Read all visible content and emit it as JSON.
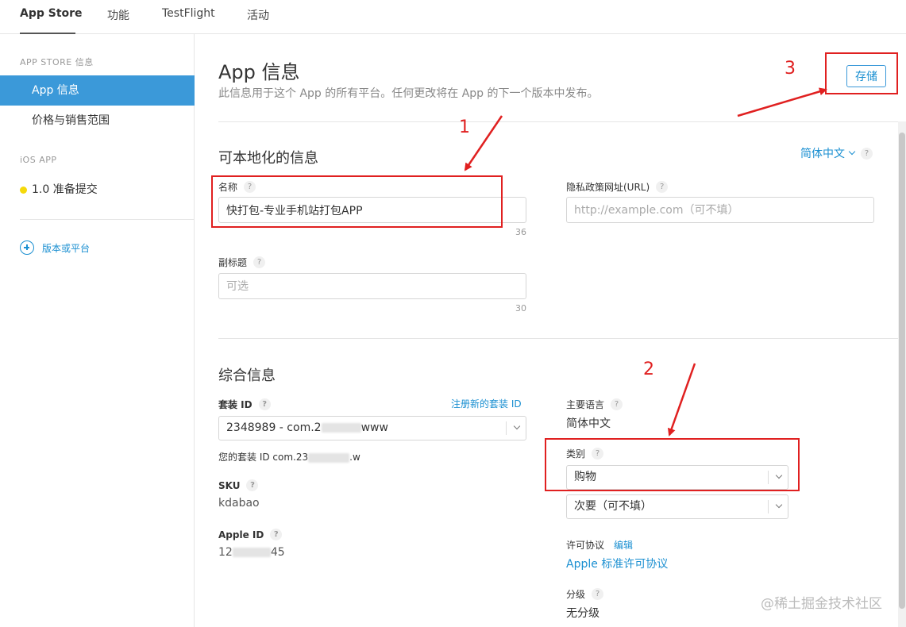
{
  "topnav": {
    "tabs": [
      {
        "label": "App Store"
      },
      {
        "label": "功能"
      },
      {
        "label": "TestFlight"
      },
      {
        "label": "活动"
      }
    ]
  },
  "sidebar": {
    "section_store": "APP STORE 信息",
    "items": [
      {
        "label": "App 信息"
      },
      {
        "label": "价格与销售范围"
      }
    ],
    "section_ios": "iOS APP",
    "version": "1.0 准备提交",
    "add_platform": "版本或平台"
  },
  "main": {
    "title": "App 信息",
    "subtitle": "此信息用于这个 App 的所有平台。任何更改将在 App 的下一个版本中发布。",
    "save_label": "存储",
    "localizable": {
      "title": "可本地化的信息",
      "language": "简体中文",
      "name_label": "名称",
      "name_value": "快打包-专业手机站打包APP",
      "name_counter": "36",
      "privacy_label": "隐私政策网址(URL)",
      "privacy_placeholder": "http://example.com（可不填）",
      "subtitle_label": "副标题",
      "subtitle_placeholder": "可选",
      "subtitle_counter": "30"
    },
    "general": {
      "title": "综合信息",
      "bundle_label": "套装 ID",
      "register_link": "注册新的套装 ID",
      "bundle_value_start": "2348989 - com.2",
      "bundle_value_end": "www",
      "bundle_note_start": "您的套装 ID com.23",
      "bundle_note_end": ".w",
      "sku_label": "SKU",
      "sku_value": "kdabao",
      "apple_id_label": "Apple ID",
      "apple_id_start": "12",
      "apple_id_end": "45",
      "primary_lang_label": "主要语言",
      "primary_lang_value": "简体中文",
      "category_label": "类别",
      "category_value": "购物",
      "secondary_value": "次要（可不填）",
      "license_label": "许可协议",
      "license_edit": "编辑",
      "license_value": "Apple 标准许可协议",
      "rating_label": "分级",
      "rating_value": "无分级"
    }
  },
  "annotations": {
    "num1": "1",
    "num2": "2",
    "num3": "3",
    "color": "#e02020"
  },
  "watermark": "@稀土掘金技术社区",
  "colors": {
    "accent": "#3b99d9",
    "link": "#1a8fd1",
    "status_dot": "#f5d90a"
  }
}
